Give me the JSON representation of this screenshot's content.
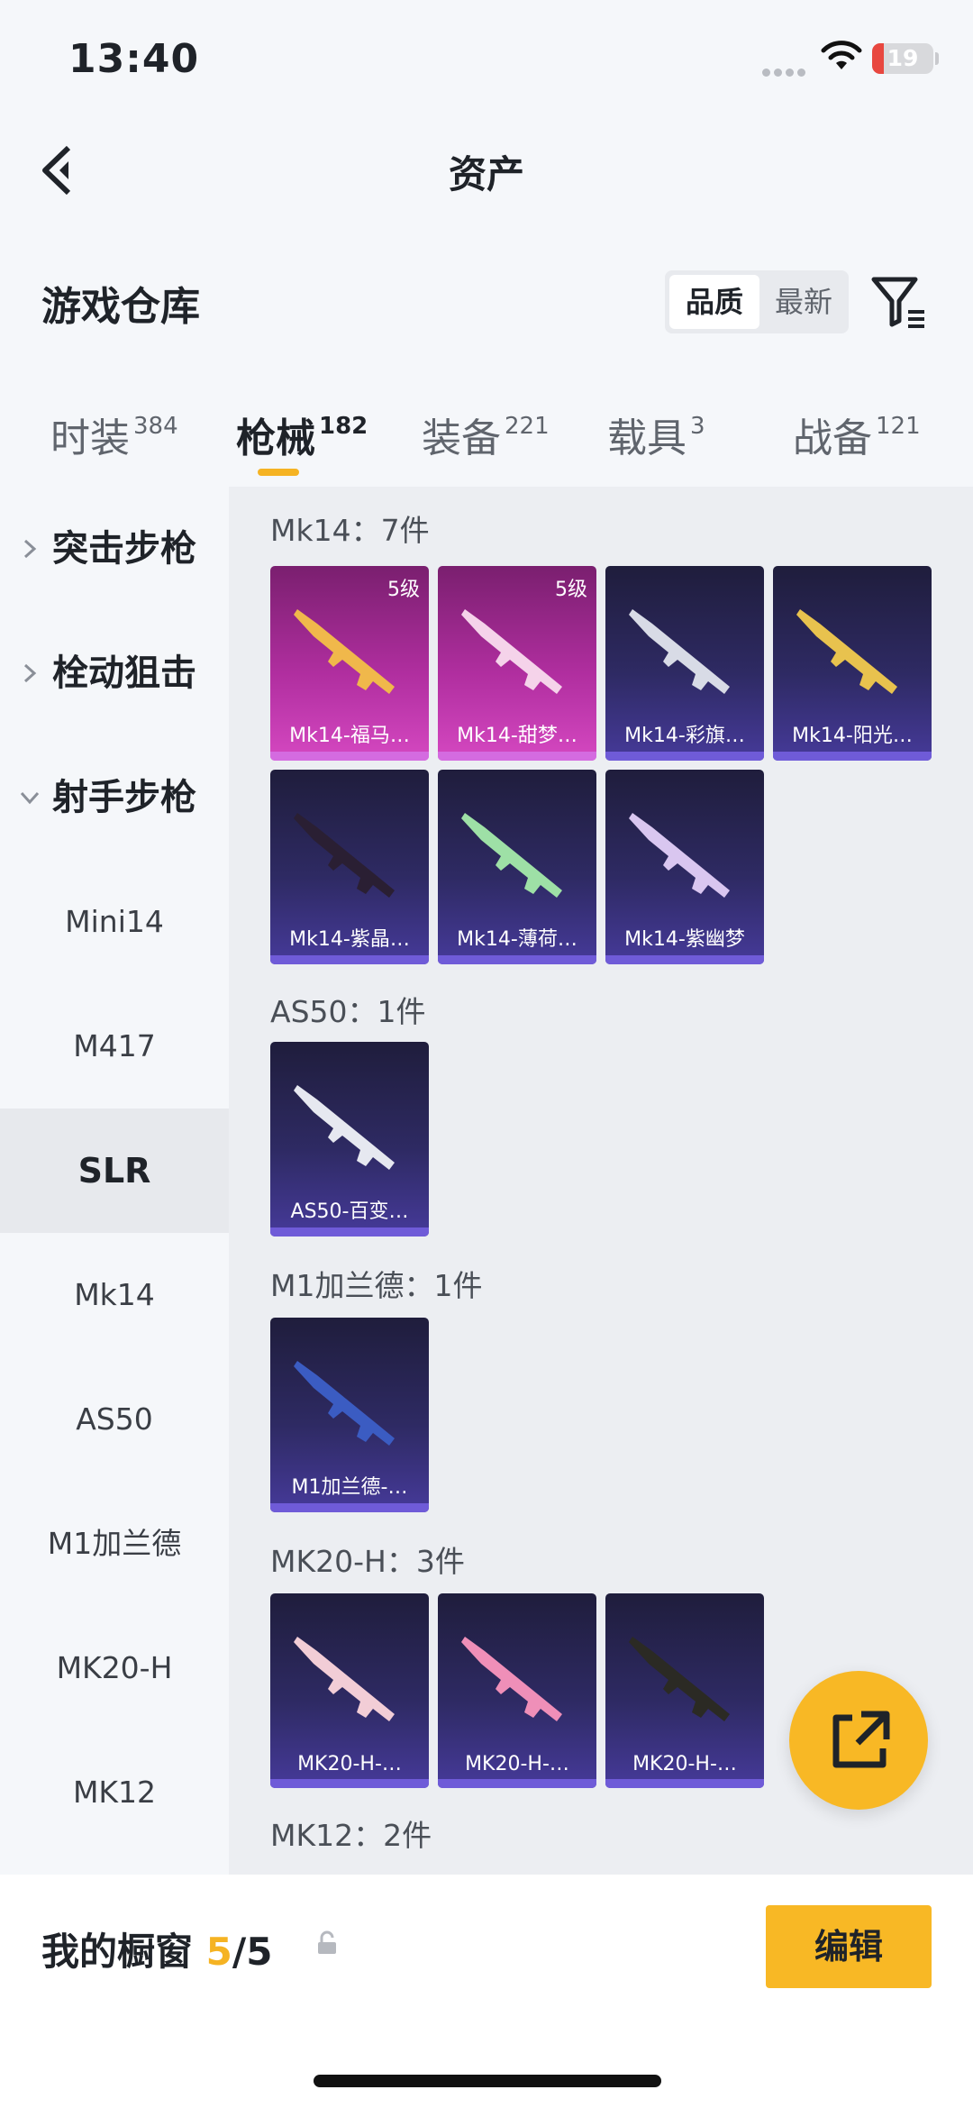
{
  "status_bar": {
    "time": "13:40",
    "battery": "19",
    "battery_level": 0.19
  },
  "nav": {
    "title": "资产"
  },
  "header": {
    "title": "游戏仓库",
    "sort_active": "品质",
    "sort_other": "最新"
  },
  "tabs": [
    {
      "label": "时装",
      "count": "384"
    },
    {
      "label": "枪械",
      "count": "182"
    },
    {
      "label": "装备",
      "count": "221"
    },
    {
      "label": "载具",
      "count": "3"
    },
    {
      "label": "战备",
      "count": "121"
    }
  ],
  "sidebar": {
    "groups": [
      "突击步枪",
      "栓动狙击",
      "射手步枪"
    ],
    "items": [
      "Mini14",
      "M417",
      "SLR",
      "Mk14",
      "AS50",
      "M1加兰德",
      "MK20-H",
      "MK12"
    ]
  },
  "groups": [
    {
      "title": "Mk14：7件",
      "cards": [
        {
          "name": "Mk14-福马…",
          "level": "5级"
        },
        {
          "name": "Mk14-甜梦…",
          "level": "5级"
        },
        {
          "name": "Mk14-彩旗…"
        },
        {
          "name": "Mk14-阳光…"
        },
        {
          "name": "Mk14-紫晶…"
        },
        {
          "name": "Mk14-薄荷…"
        },
        {
          "name": "Mk14-紫幽梦"
        }
      ]
    },
    {
      "title": "AS50：1件",
      "cards": [
        {
          "name": "AS50-百变…"
        }
      ]
    },
    {
      "title": "M1加兰德：1件",
      "cards": [
        {
          "name": "M1加兰德-…"
        }
      ]
    },
    {
      "title": "MK20-H：3件",
      "cards": [
        {
          "name": "MK20-H-…"
        },
        {
          "name": "MK20-H-…"
        },
        {
          "name": "MK20-H-…"
        }
      ]
    },
    {
      "title": "MK12：2件"
    }
  ],
  "showcase": {
    "label": "我的橱窗",
    "current": "5",
    "total": "/5",
    "edit": "编辑"
  },
  "colors": {
    "accent": "#f8b825",
    "epic": "#c13cae",
    "rare": "#3a3373"
  }
}
